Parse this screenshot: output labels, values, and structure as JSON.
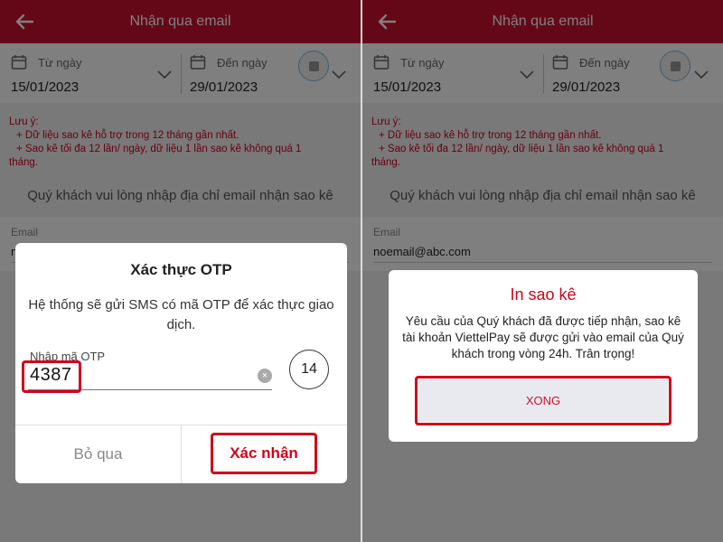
{
  "screen": {
    "title": "Nhận qua email",
    "from_label": "Từ ngày",
    "from_value": "15/01/2023",
    "to_label": "Đến ngày",
    "to_value": "29/01/2023",
    "note_title": "Lưu ý:",
    "note_line1": "+ Dữ liệu sao kê hỗ trợ trong 12 tháng gần nhất.",
    "note_line2": "+ Sao kê tối đa 12 lần/ ngày, dữ liệu 1 lần sao kê không quá 1",
    "note_line3": "tháng.",
    "instruction": "Quý khách vui lòng nhập địa chỉ email nhận sao kê",
    "email_label": "Email",
    "email_value_left": "n",
    "email_value_right": "noemail@abc.com"
  },
  "otp_dialog": {
    "title": "Xác thực OTP",
    "message": "Hệ thống sẽ gửi SMS có mã OTP để xác thực giao dịch.",
    "otp_label": "Nhập mã OTP",
    "otp_value": "4387",
    "clear_glyph": "×",
    "countdown": "14",
    "skip_label": "Bỏ qua",
    "confirm_label": "Xác nhận"
  },
  "done_dialog": {
    "title": "In sao kê",
    "message": "Yêu cầu của Quý khách đã được tiếp nhận, sao kê tài khoản ViettelPay sẽ được gửi vào email của Quý khách trong vòng 24h. Trân trọng!",
    "done_label": "XONG"
  },
  "colors": {
    "brand": "#c8102e",
    "highlight": "#d0021b"
  }
}
